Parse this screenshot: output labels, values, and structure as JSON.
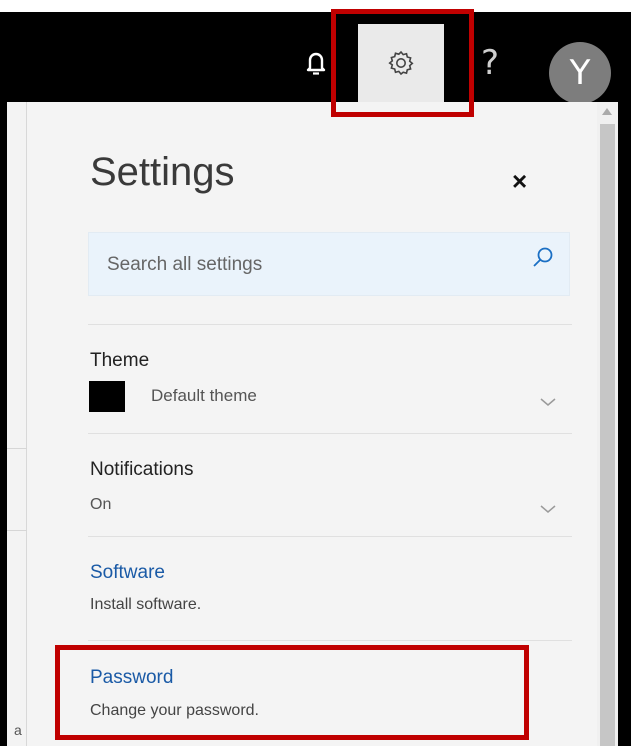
{
  "topbar": {
    "icons": {
      "notifications": "bell-icon",
      "settings": "gear-icon",
      "help": "help-icon"
    },
    "help_glyph": "?",
    "avatar_initial": "Y"
  },
  "settings_pane": {
    "title": "Settings",
    "close_glyph": "×",
    "search": {
      "placeholder": "Search all settings",
      "icon": "search-icon"
    },
    "theme": {
      "label": "Theme",
      "value": "Default theme",
      "swatch_color": "#000000"
    },
    "notifications": {
      "label": "Notifications",
      "value": "On"
    },
    "software": {
      "label": "Software",
      "description": "Install software."
    },
    "password": {
      "label": "Password",
      "description": "Change your password."
    }
  },
  "stray_text": "a",
  "colors": {
    "link": "#1a5aa6",
    "highlight": "#c00000",
    "search_bg": "#eaf3fb"
  }
}
